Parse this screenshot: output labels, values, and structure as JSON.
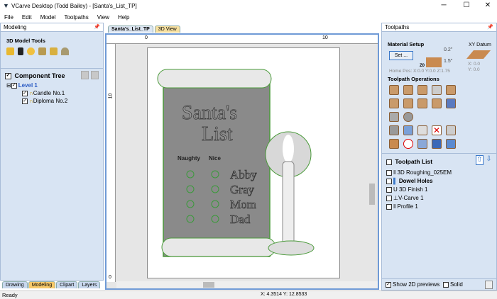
{
  "window": {
    "title": "VCarve Desktop (Todd Bailey) - [Santa's_List_TP]",
    "minimize": "─",
    "maximize": "☐",
    "close": "✕"
  },
  "menu": [
    "File",
    "Edit",
    "Model",
    "Toolpaths",
    "View",
    "Help"
  ],
  "left_panel": {
    "title": "Modeling",
    "tools_title": "3D Model Tools",
    "tools": [
      "open-component-icon",
      "key-icon",
      "arrows-icon",
      "texture-icon",
      "lock-icon",
      "dome-icon"
    ],
    "tree_title": "Component Tree",
    "tree": [
      {
        "label": "Level 1"
      },
      {
        "label": "Candle No.1"
      },
      {
        "label": "Diploma No.2"
      }
    ],
    "tabs": [
      "Drawing",
      "Modeling",
      "Clipart",
      "Layers"
    ]
  },
  "doc_tabs": [
    "Santa's_List_TP",
    "3D View"
  ],
  "ruler": {
    "x_ticks": [
      "0",
      "10"
    ],
    "y_ticks": [
      "10",
      "0"
    ]
  },
  "drawing": {
    "title1": "Santa's",
    "title2": "List",
    "col1": "Naughty",
    "col2": "Nice",
    "names": [
      "Abby",
      "Gray",
      "Mom",
      "Dad"
    ]
  },
  "right_panel": {
    "title": "Toolpaths",
    "material_setup": "Material Setup",
    "set_button": "Set ...",
    "dim_top": "0.2\"",
    "dim_thick": "1.5\"",
    "z0": "Z0",
    "home_pos": "Home Pos:  X:0.0 Y:0.0 Z:1.75",
    "xy_datum": "XY Datum",
    "datum_x": "X: 0.0",
    "datum_y": "Y: 0.0",
    "ops_title": "Toolpath Operations",
    "toolpath_list_title": "Toolpath List",
    "toolpaths": [
      {
        "label": "3D Roughing_025EM",
        "bold": false
      },
      {
        "label": "Dowel Holes",
        "bold": true
      },
      {
        "label": "3D Finish 1",
        "bold": false
      },
      {
        "label": "V-Carve 1",
        "bold": false
      },
      {
        "label": "Profile 1",
        "bold": false
      }
    ],
    "show_2d": "Show 2D previews",
    "solid": "Solid"
  },
  "status": {
    "text": "Ready",
    "coords": "X: 4.3514 Y: 12.8533"
  },
  "colors": {
    "panel": "#d8e4f3",
    "accent": "#3a78c9",
    "active_tab": "#f7c96a"
  }
}
